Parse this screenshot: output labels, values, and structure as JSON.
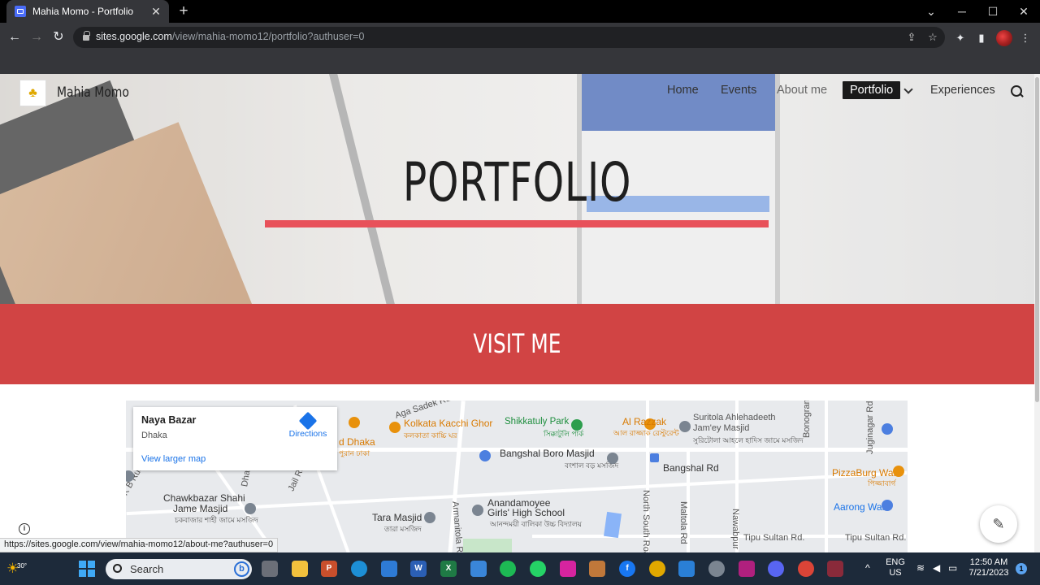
{
  "browser": {
    "tab_title": "Mahia Momo - Portfolio",
    "tab_close": "✕",
    "new_tab": "+",
    "url_host": "sites.google.com",
    "url_path": "/view/mahia-momo12/portfolio?authuser=0",
    "status_url": "https://sites.google.com/view/mahia-momo12/about-me?authuser=0"
  },
  "site": {
    "name": "Mahia Momo",
    "nav": [
      "Home",
      "Events",
      "About me",
      "Portfolio",
      "Experiences"
    ],
    "active_nav": "Portfolio",
    "hero_title": "PORTFOLIO",
    "section_title": "VISIT ME",
    "accent_color": "#d14444",
    "rule_color": "#e8515a"
  },
  "map": {
    "place": "Naya Bazar",
    "city": "Dhaka",
    "directions": "Directions",
    "larger_map": "View larger map",
    "labels": {
      "aga_sadek": "Aga Sadek Rd",
      "kacchi": "Kolkata Kacchi Ghor",
      "kacchi_bn": "কলকাতা কাচ্চি ঘর",
      "shikkatuly": "Shikkatuly Park",
      "shikkatuly_bn": "সিক্কাটুলি পার্ক",
      "razzak": "Al Razzak",
      "razzak_bn": "আল রাজ্জাক রেস্টুরেন্ট",
      "suritola": "Suritola Ahlehadeeth",
      "jamey": "Jam'ey Masjid",
      "suritola_bn": "সুরিটোলা আহলে হাদিস জামে মসজিদ",
      "dhaka_partial": "d Dhaka",
      "dhaka_bn": "পুরান ঢাকা",
      "bangshal_masjid": "Bangshal Boro Masjid",
      "bangshal_masjid_bn": "বংশাল বড় মসজিদ",
      "bangshal_rd": "Bangshal Rd",
      "bonogram": "Bonogram Rd",
      "juginagar": "Juginagar Rd",
      "pizzaburg": "PizzaBurg Wari",
      "pizzaburg_bn": "পিজ্জাবার্গ",
      "rudra": "K B Rudro Rd",
      "chawkbazar": "Chawkbazar Shahi",
      "jame_masjid": "Jame Masjid",
      "chawkbazar_bn": "চকবাজার শাহী জামে মসজিদ",
      "jail_rd": "Jail Rd",
      "dhaka_rd": "Dhaka Rd",
      "anandamoyee": "Anandamoyee",
      "girls_school": "Girls' High School",
      "anandamoyee_bn": "আনন্দময়ী বালিকা উচ্চ বিদ্যালয়",
      "tara_masjid": "Tara Masjid",
      "tara_masjid_bn": "তারা মসজিদ",
      "armanitola": "Armanitola Rd",
      "north_south": "North South Road",
      "maltola": "Maltola Rd",
      "nawabpur": "Nawabpur Rd",
      "tipu1": "Tipu Sultan Rd.",
      "tipu2": "Tipu Sultan Rd.",
      "aarong": "Aarong Wari",
      "r": "R"
    }
  },
  "taskbar": {
    "search_placeholder": "Search",
    "weather_temp": "30°",
    "lang1": "ENG",
    "lang2": "US",
    "time": "12:50 AM",
    "date": "7/21/2023",
    "notif_count": "1"
  },
  "icons": {
    "back": "←",
    "forward": "→",
    "reload": "↻",
    "share": "⇪",
    "star": "☆",
    "extensions": "✦",
    "sidebar": "▮",
    "menu": "⋮",
    "minimize": "─",
    "maximize": "☐",
    "close": "✕",
    "dropdown": "⌄",
    "edit": "✎",
    "info": "i",
    "weather": "☀",
    "logo": "♣",
    "tray_up": "^",
    "wifi": "≋",
    "volume": "◀",
    "battery": "▭"
  }
}
